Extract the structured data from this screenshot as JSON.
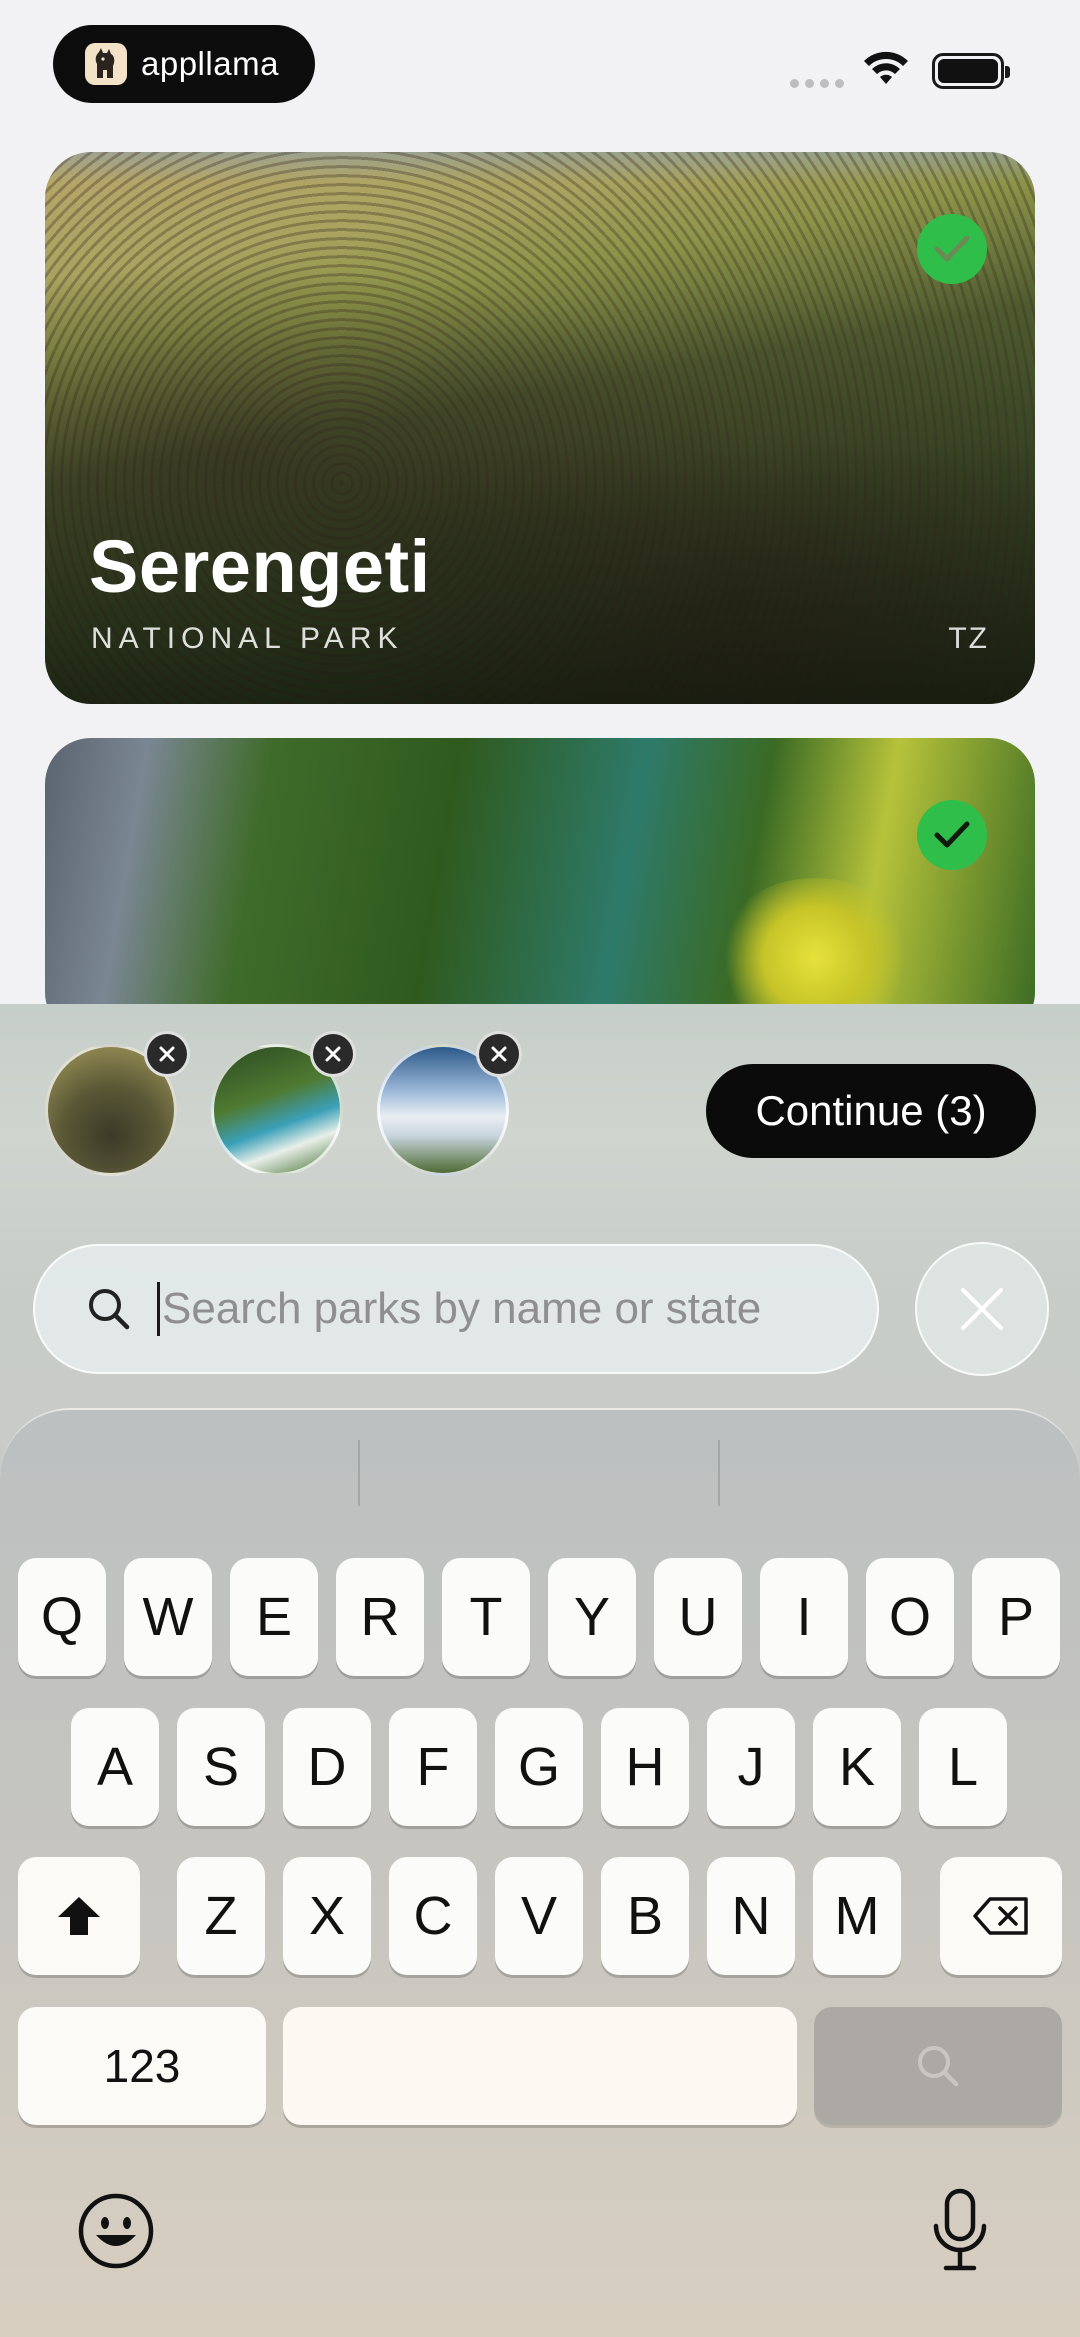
{
  "status_bar": {
    "brand_name": "appllama",
    "icons": [
      "llama-logo-icon",
      "cellular-signal-icon",
      "wifi-icon",
      "battery-icon"
    ]
  },
  "parks": [
    {
      "title": "Serengeti",
      "subtitle": "NATIONAL PARK",
      "code": "TZ",
      "selected": true
    },
    {
      "title": "",
      "subtitle": "",
      "code": "",
      "selected": true
    }
  ],
  "selection": {
    "thumbnails": [
      "Serengeti",
      "waterfall-park",
      "mountain-lake-park"
    ],
    "continue_label": "Continue (3)"
  },
  "search": {
    "placeholder": "Search parks by name or state",
    "value": ""
  },
  "keyboard": {
    "row1": [
      "Q",
      "W",
      "E",
      "R",
      "T",
      "Y",
      "U",
      "I",
      "O",
      "P"
    ],
    "row2": [
      "A",
      "S",
      "D",
      "F",
      "G",
      "H",
      "J",
      "K",
      "L"
    ],
    "row3": [
      "Z",
      "X",
      "C",
      "V",
      "B",
      "N",
      "M"
    ],
    "numbers_label": "123",
    "space_label": "",
    "return_icon": "search-icon"
  },
  "colors": {
    "check_green": "#2fbe4a",
    "button_black": "#0b0b0b"
  }
}
